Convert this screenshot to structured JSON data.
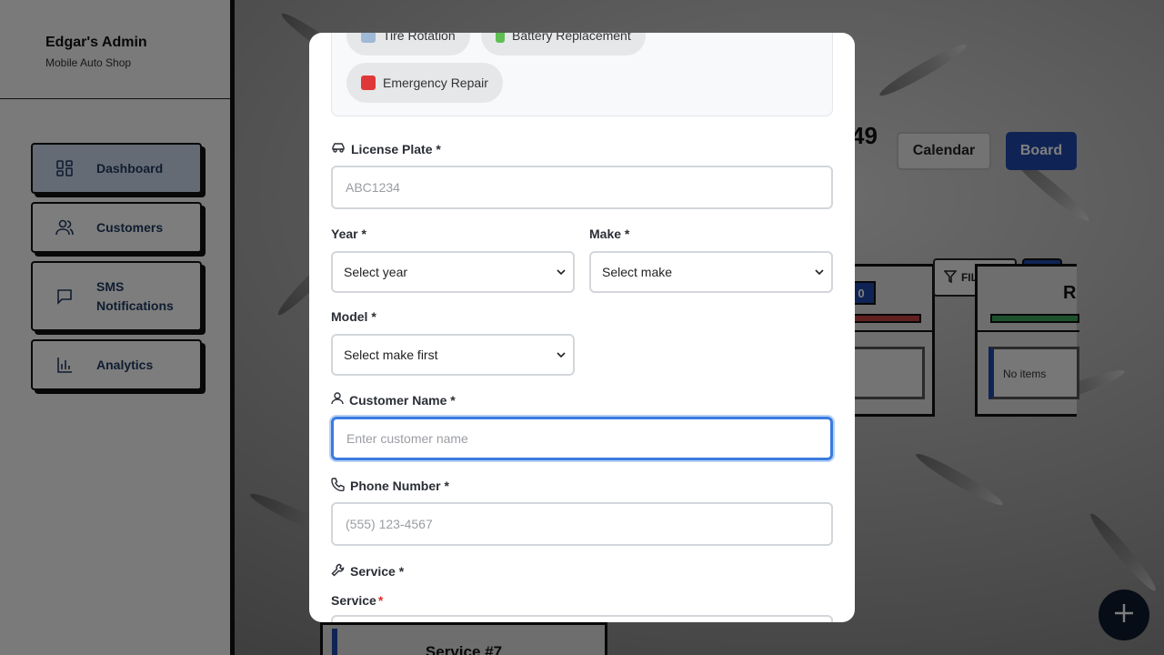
{
  "sidebar": {
    "title": "Edgar's Admin",
    "subtitle": "Mobile Auto Shop",
    "items": [
      {
        "label": "Dashboard",
        "icon": "dashboard-grid-icon",
        "active": true
      },
      {
        "label": "Customers",
        "icon": "users-icon"
      },
      {
        "label": "SMS Notifications",
        "icon": "chat-bubble-icon"
      },
      {
        "label": "Analytics",
        "icon": "bar-chart-icon"
      }
    ]
  },
  "background": {
    "partial_number": "49",
    "calendar_label": "Calendar",
    "board_label": "Board",
    "filters_label": "FILTERS",
    "column_badge": "0",
    "column_partial_letter": "R",
    "no_items": "No items",
    "service_card_title": "Service #7"
  },
  "modal": {
    "services": [
      {
        "label": "Tire Rotation",
        "icon": "tire-icon"
      },
      {
        "label": "Battery Replacement",
        "icon": "battery-icon"
      },
      {
        "label": "Emergency Repair",
        "icon": "siren-icon"
      }
    ],
    "license": {
      "label": "License Plate *",
      "placeholder": "ABC1234"
    },
    "year": {
      "label": "Year *",
      "value": "Select year"
    },
    "make": {
      "label": "Make *",
      "value": "Select make"
    },
    "model": {
      "label": "Model *",
      "value": "Select make first"
    },
    "customer": {
      "label": "Customer Name *",
      "placeholder": "Enter customer name"
    },
    "phone": {
      "label": "Phone Number *",
      "placeholder": "(555) 123-4567"
    },
    "service_section": {
      "label": "Service *"
    },
    "service_field": {
      "label": "Service",
      "required_mark": "*"
    }
  },
  "colors": {
    "accent_blue": "#3a7be0",
    "board_button": "#1f48a8",
    "required": "#e0302a"
  }
}
